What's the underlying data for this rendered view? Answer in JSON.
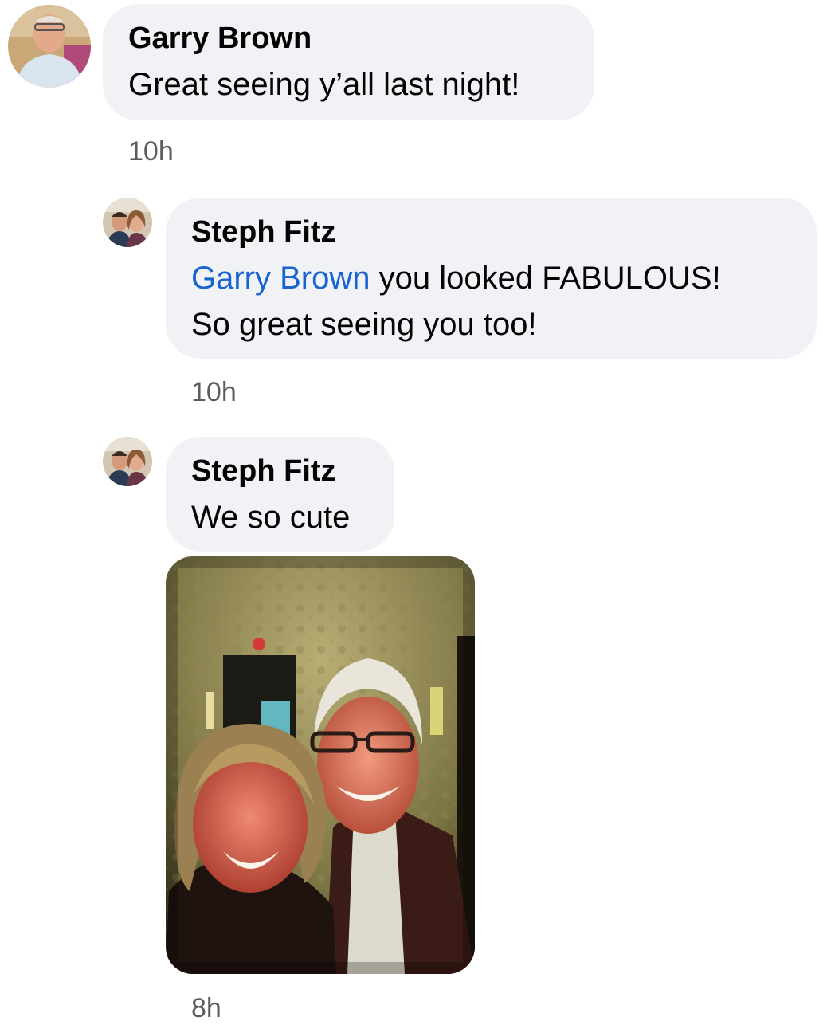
{
  "comments": [
    {
      "author": "Garry Brown",
      "text": "Great seeing y’all last night!",
      "time": "10h",
      "avatar_icon": "profile-photo-man-avatar"
    },
    {
      "author": "Steph Fitz",
      "mention": "Garry Brown",
      "text_after_mention": " you looked FABULOUS!",
      "text_line2": "So great seeing you too!",
      "time": "10h",
      "avatar_icon": "profile-photo-couple-avatar"
    },
    {
      "author": "Steph Fitz",
      "text": "We so cute",
      "time": "8h",
      "avatar_icon": "profile-photo-couple-avatar",
      "attachment": "selfie-photo"
    }
  ],
  "colors": {
    "bubble": "#f0f2f5",
    "mention": "#1763cf",
    "timestamp": "#5b5d61"
  }
}
